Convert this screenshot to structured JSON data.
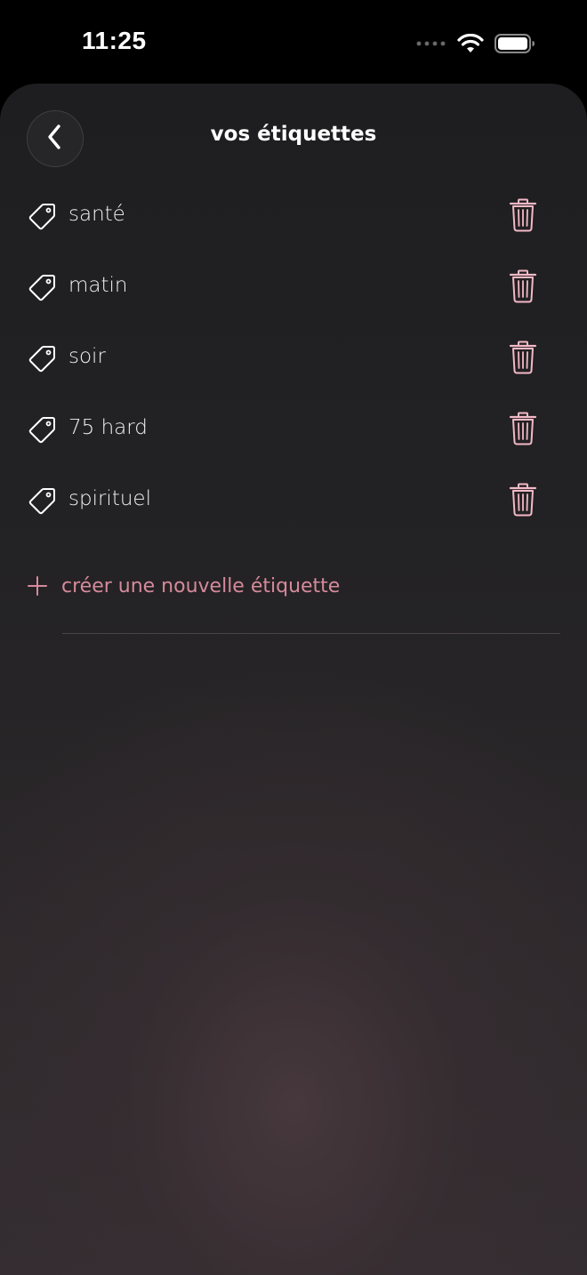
{
  "status_bar": {
    "time": "11:25"
  },
  "header": {
    "title": "vos étiquettes",
    "back_icon": "chevron-left-icon"
  },
  "tags": [
    {
      "label": "santé"
    },
    {
      "label": "matin"
    },
    {
      "label": "soir"
    },
    {
      "label": "75 hard"
    },
    {
      "label": "spirituel"
    }
  ],
  "actions": {
    "create_label": "créer une nouvelle étiquette"
  },
  "icons": {
    "tag": "tag-icon",
    "delete": "trash-icon",
    "add": "plus-icon"
  },
  "colors": {
    "accent": "#d58a9b",
    "trash": "#f3b9c6",
    "background_top": "#1e1e20",
    "background_bottom": "#342d31"
  }
}
